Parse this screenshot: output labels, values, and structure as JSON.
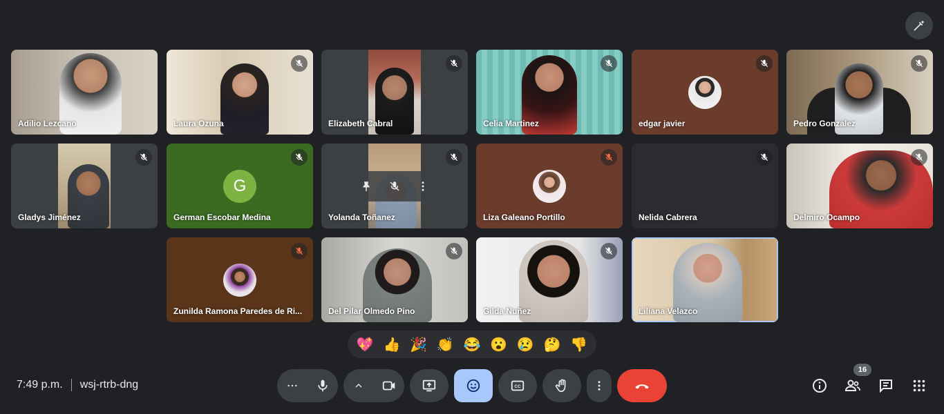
{
  "participants": [
    {
      "name": "Adilio Lezcano",
      "muted": false
    },
    {
      "name": "Laura Ozuna",
      "muted": true
    },
    {
      "name": "Elizabeth Cabral",
      "muted": true
    },
    {
      "name": "Celia Martinez",
      "muted": true
    },
    {
      "name": "edgar javier",
      "muted": true
    },
    {
      "name": "Pedro Gonzalez",
      "muted": true
    },
    {
      "name": "Gladys Jiménez",
      "muted": true
    },
    {
      "name": "German Escobar Medina",
      "muted": true,
      "avatar_letter": "G"
    },
    {
      "name": "Yolanda Toñanez",
      "muted": true
    },
    {
      "name": "Liza Galeano Portillo",
      "muted": true
    },
    {
      "name": "Nelida Cabrera",
      "muted": true
    },
    {
      "name": "Delmiro Ocampo",
      "muted": true
    },
    {
      "name": "Zunilda Ramona Paredes de Ri...",
      "muted": true
    },
    {
      "name": "Del Pilar Olmedo Pino",
      "muted": true
    },
    {
      "name": "Gilda Nuñez",
      "muted": true
    },
    {
      "name": "Liliana Velazco",
      "muted": false
    }
  ],
  "reactions": [
    "💖",
    "👍",
    "🎉",
    "👏",
    "😂",
    "😮",
    "😢",
    "🤔",
    "👎"
  ],
  "meeting": {
    "time": "7:49 p.m.",
    "code": "wsj-rtrb-dng"
  },
  "people_count": "16",
  "colors": {
    "background": "#202124",
    "tile": "#3c4043",
    "active_blue": "#a8c7fa",
    "leave_red": "#ea4335"
  }
}
